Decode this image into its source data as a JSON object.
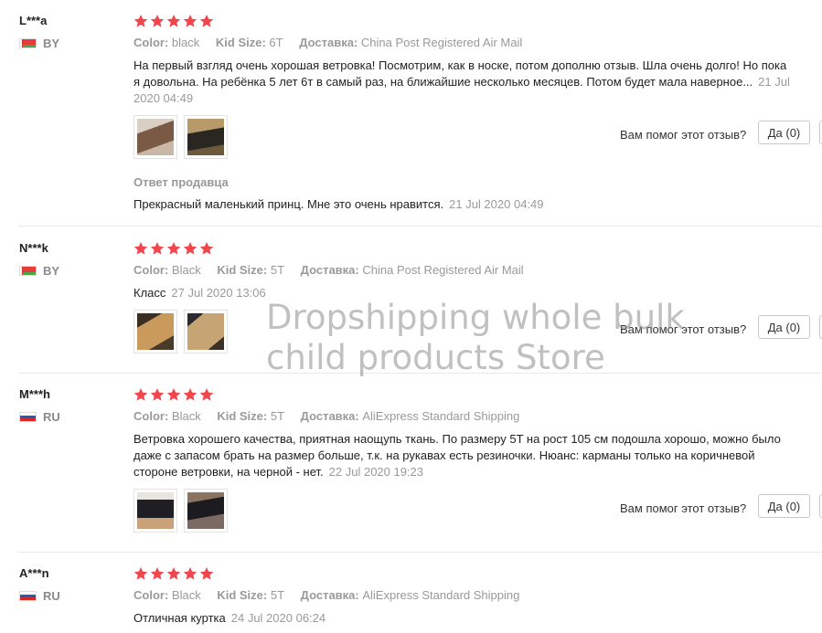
{
  "labels": {
    "color": "Color:",
    "kid_size": "Kid Size:",
    "delivery": "Доставка:",
    "helpful": "Вам помог этот отзыв?",
    "seller_reply": "Ответ продавца"
  },
  "watermark": {
    "line1": "Dropshipping whole bulk",
    "line2": "child products Store"
  },
  "reviews": [
    {
      "user": "L***a",
      "country": "BY",
      "rating": 5,
      "color": "black",
      "size": "6T",
      "shipping": "China Post Registered Air Mail",
      "text": "На первый взгляд очень хорошая ветровка! Посмотрим, как в носке, потом дополню отзыв. Шла очень долго! Но пока я довольна. На ребёнка 5 лет 6т в самый раз, на ближайшие несколько месяцев. Потом будет мала наверное...",
      "date": "21 Jul 2020 04:49",
      "yes": "Да (0)",
      "seller_text": "Прекрасный маленький принц. Мне это очень нравится.",
      "seller_date": "21 Jul 2020 04:49"
    },
    {
      "user": "N***k",
      "country": "BY",
      "rating": 5,
      "color": "Black",
      "size": "5T",
      "shipping": "China Post Registered Air Mail",
      "text": "Класс",
      "date": "27 Jul 2020 13:06",
      "yes": "Да (0)"
    },
    {
      "user": "M***h",
      "country": "RU",
      "rating": 5,
      "color": "Black",
      "size": "5T",
      "shipping": "AliExpress Standard Shipping",
      "text": "Ветровка хорошего качества, приятная наощупь ткань. По размеру 5T на рост 105 см подошла хорошо, можно было даже с запасом брать на размер больше, т.к. на рукавах есть резиночки. Нюанс: карманы только на коричневой стороне ветровки, на черной - нет.",
      "date": "22 Jul 2020 19:23",
      "yes": "Да (0)"
    },
    {
      "user": "A***n",
      "country": "RU",
      "rating": 5,
      "color": "Black",
      "size": "5T",
      "shipping": "AliExpress Standard Shipping",
      "text": "Отличная куртка",
      "date": "24 Jul 2020 06:24"
    }
  ]
}
